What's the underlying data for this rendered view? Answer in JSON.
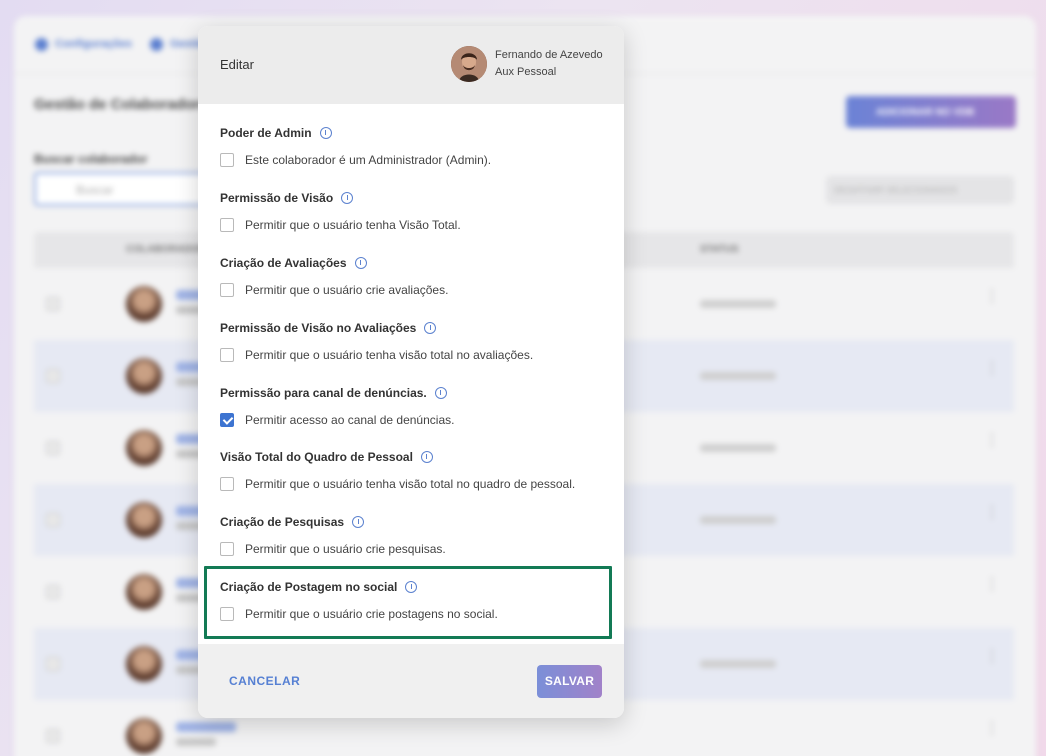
{
  "background": {
    "breadcrumb": [
      "Configurações",
      "Gestão"
    ],
    "page_title": "Gestão de Colaboradores",
    "add_button_label": "ADICIONAR NO VDB",
    "search_label": "Buscar colaborador",
    "search_placeholder": "Buscar",
    "disabled_button_label": "DESATIVAR SELECIONADOS",
    "table_headers": [
      "COLABORADOR",
      "STATUS"
    ],
    "row_status": "Gestão de decisões"
  },
  "modal": {
    "title": "Editar",
    "user": {
      "name": "Fernando de Azevedo",
      "role": "Aux Pessoal"
    },
    "permissions": [
      {
        "title": "Poder de Admin",
        "label": "Este colaborador é um Administrador (Admin).",
        "checked": false
      },
      {
        "title": "Permissão de Visão",
        "label": "Permitir que o usuário tenha Visão Total.",
        "checked": false
      },
      {
        "title": "Criação de Avaliações",
        "label": "Permitir que o usuário crie avaliações.",
        "checked": false
      },
      {
        "title": "Permissão de Visão no Avaliações",
        "label": "Permitir que o usuário tenha visão total no avaliações.",
        "checked": false
      },
      {
        "title": "Permissão para canal de denúncias.",
        "label": "Permitir acesso ao canal de denúncias.",
        "checked": true
      },
      {
        "title": "Visão Total do Quadro de Pessoal",
        "label": "Permitir que o usuário tenha visão total no quadro de pessoal.",
        "checked": false
      },
      {
        "title": "Criação de Pesquisas",
        "label": "Permitir que o usuário crie pesquisas.",
        "checked": false
      },
      {
        "title": "Criação de Postagem no social",
        "label": "Permitir que o usuário crie postagens no social.",
        "checked": false
      }
    ],
    "cancel_label": "CANCELAR",
    "save_label": "SALVAR"
  },
  "colors": {
    "accent": "#3d74d1",
    "highlight_border": "#137a55",
    "save_gradient": [
      "#7b8fd8",
      "#a182c9"
    ]
  }
}
